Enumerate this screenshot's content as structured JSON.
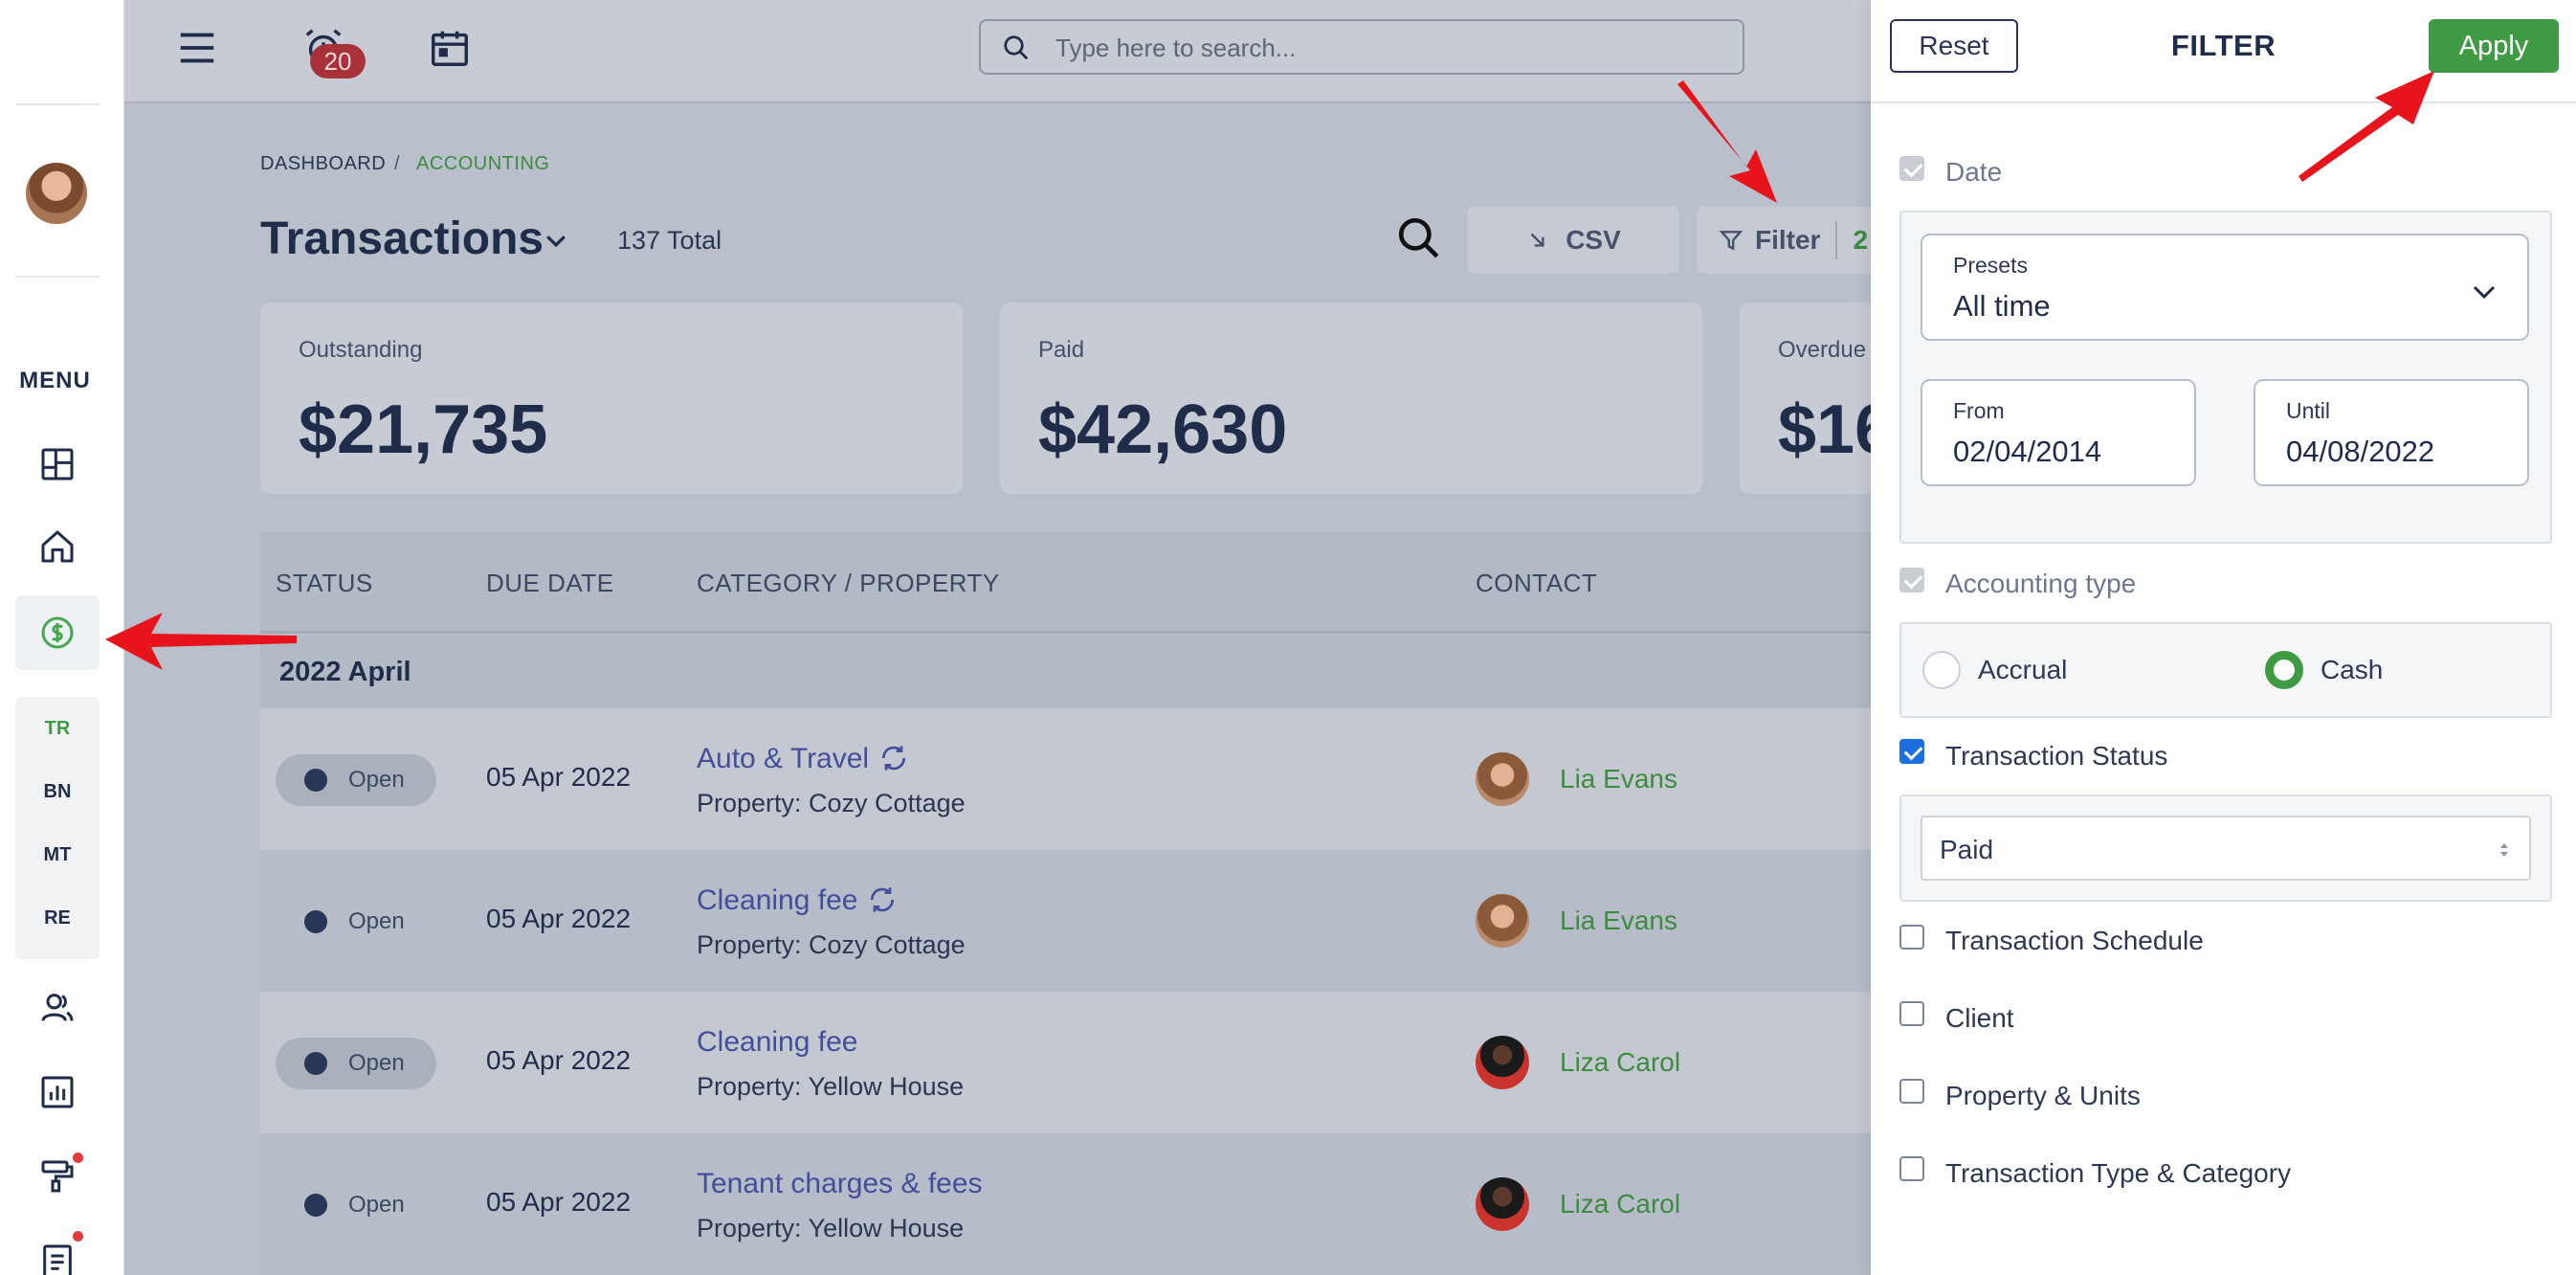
{
  "rail": {
    "menu_label": "MENU",
    "sub_items": [
      "TR",
      "BN",
      "MT",
      "RE"
    ]
  },
  "topbar": {
    "notification_count": "20",
    "search_placeholder": "Type here to search..."
  },
  "breadcrumb": {
    "root": "DASHBOARD",
    "separator": "/",
    "current": "ACCOUNTING"
  },
  "page": {
    "title": "Transactions",
    "total": "137 Total"
  },
  "toolbar": {
    "csv_label": "CSV",
    "filter_label": "Filter",
    "filter_count": "2"
  },
  "stats": [
    {
      "label": "Outstanding",
      "value": "$21,735"
    },
    {
      "label": "Paid",
      "value": "$42,630"
    },
    {
      "label": "Overdue",
      "value": "$16"
    }
  ],
  "table": {
    "headers": [
      "STATUS",
      "DUE DATE",
      "CATEGORY / PROPERTY",
      "CONTACT"
    ],
    "group": "2022 April",
    "rows": [
      {
        "status": "Open",
        "due": "05 Apr 2022",
        "category": "Auto & Travel",
        "recurring": true,
        "property": "Property: Cozy Cottage",
        "contact": "Lia Evans"
      },
      {
        "status": "Open",
        "due": "05 Apr 2022",
        "category": "Cleaning fee",
        "recurring": true,
        "property": "Property: Cozy Cottage",
        "contact": "Lia Evans"
      },
      {
        "status": "Open",
        "due": "05 Apr 2022",
        "category": "Cleaning fee",
        "recurring": false,
        "property": "Property: Yellow House",
        "contact": "Liza Carol"
      },
      {
        "status": "Open",
        "due": "05 Apr 2022",
        "category": "Tenant charges & fees",
        "recurring": false,
        "property": "Property: Yellow House",
        "contact": "Liza Carol"
      }
    ]
  },
  "filter": {
    "reset_label": "Reset",
    "title": "FILTER",
    "apply_label": "Apply",
    "date_label": "Date",
    "presets_label": "Presets",
    "presets_value": "All time",
    "from_label": "From",
    "from_value": "02/04/2014",
    "until_label": "Until",
    "until_value": "04/08/2022",
    "accounting_type_label": "Accounting type",
    "accrual_label": "Accrual",
    "cash_label": "Cash",
    "selected_accounting": "Cash",
    "transaction_status_label": "Transaction Status",
    "transaction_status_value": "Paid",
    "transaction_schedule_label": "Transaction Schedule",
    "client_label": "Client",
    "property_units_label": "Property & Units",
    "transaction_type_label": "Transaction Type & Category"
  },
  "colors": {
    "accent_green": "#3e9b43",
    "link_purple": "#434e9b",
    "checkbox_blue": "#1b6fe0",
    "annotation_red": "#e8141b"
  }
}
